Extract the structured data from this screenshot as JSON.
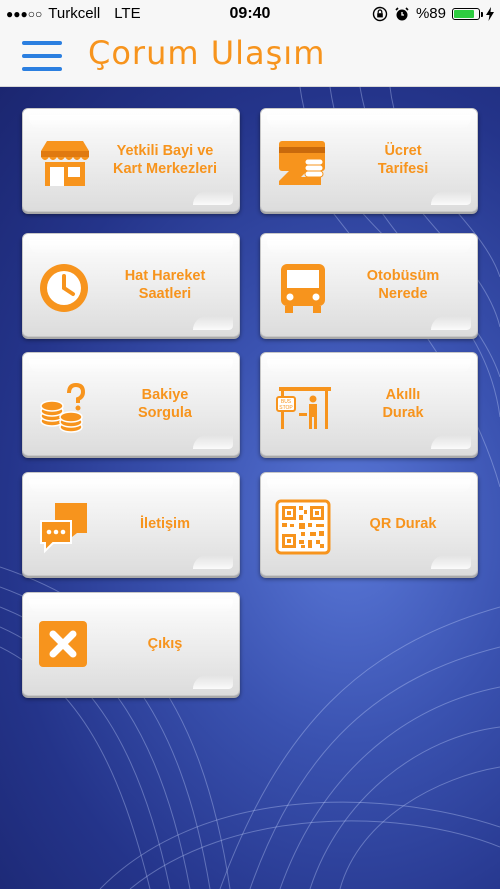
{
  "status_bar": {
    "signal_dots": "●●●○○",
    "carrier": "Turkcell",
    "network": "LTE",
    "time": "09:40",
    "battery_percent_label": "%89",
    "battery_level": 0.89
  },
  "header": {
    "title": "Çorum Ulaşım",
    "accent_color": "#f7941d",
    "menu_color": "#2b7fe0"
  },
  "menu": {
    "items": [
      {
        "label": "Yetkili Bayi ve\nKart Merkezleri",
        "icon": "shop-icon"
      },
      {
        "label": "Ücret\nTarifesi",
        "icon": "payment-card-icon"
      },
      {
        "label": "Hat Hareket\nSaatleri",
        "icon": "clock-icon"
      },
      {
        "label": "Otobüsüm\nNerede",
        "icon": "bus-icon"
      },
      {
        "label": "Bakiye\nSorgula",
        "icon": "coins-question-icon"
      },
      {
        "label": "Akıllı\nDurak",
        "icon": "bus-stop-icon"
      },
      {
        "label": "İletişim",
        "icon": "chat-icon"
      },
      {
        "label": "QR Durak",
        "icon": "qr-code-icon"
      },
      {
        "label": "Çıkış",
        "icon": "exit-x-icon"
      }
    ]
  }
}
